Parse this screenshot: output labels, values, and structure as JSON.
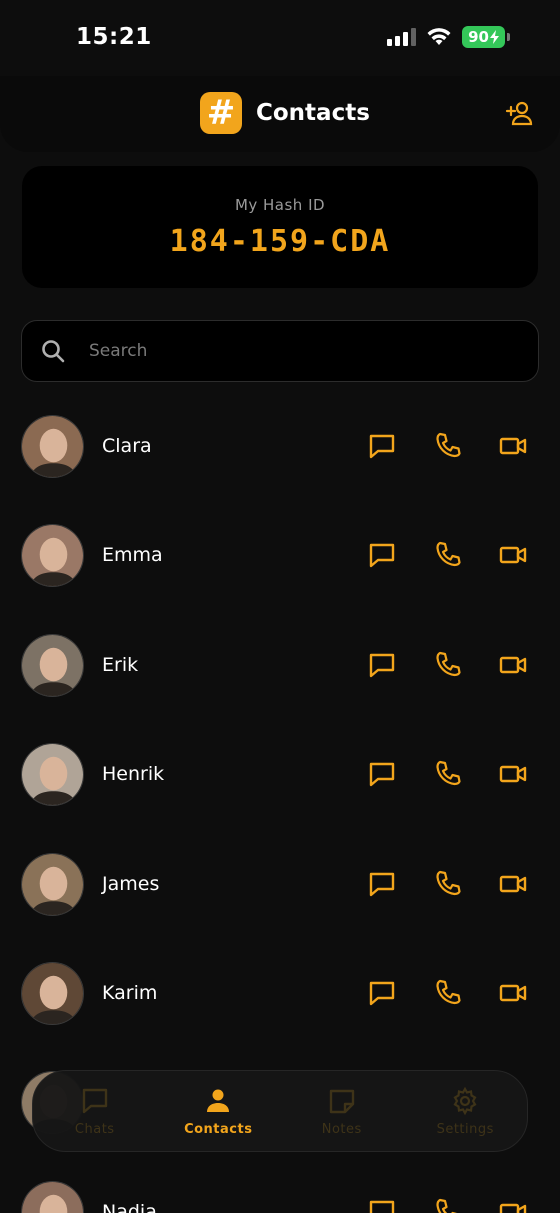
{
  "status_bar": {
    "time": "15:21",
    "battery": "90"
  },
  "header": {
    "title": "Contacts",
    "logo_glyph": "#"
  },
  "hash_card": {
    "label": "My Hash ID",
    "value": "184-159-CDA"
  },
  "search": {
    "placeholder": "Search",
    "value": ""
  },
  "contacts": [
    {
      "name": "Clara",
      "avatar_color": "#8b6a52"
    },
    {
      "name": "Emma",
      "avatar_color": "#9a7866"
    },
    {
      "name": "Erik",
      "avatar_color": "#7d7265"
    },
    {
      "name": "Henrik",
      "avatar_color": "#b0a497"
    },
    {
      "name": "James",
      "avatar_color": "#8a7258"
    },
    {
      "name": "Karim",
      "avatar_color": "#5f4836"
    },
    {
      "name": "",
      "avatar_color": "#8e7b66"
    },
    {
      "name": "Nadia",
      "avatar_color": "#8c6d5c"
    }
  ],
  "tabs": [
    {
      "label": "Chats",
      "icon": "chat-icon",
      "active": false
    },
    {
      "label": "Contacts",
      "icon": "person-icon",
      "active": true
    },
    {
      "label": "Notes",
      "icon": "note-icon",
      "active": false
    },
    {
      "label": "Settings",
      "icon": "gear-icon",
      "active": false
    }
  ],
  "colors": {
    "accent": "#f2a51c",
    "background": "#0d0d0d",
    "card": "#000000",
    "battery": "#34c759"
  }
}
